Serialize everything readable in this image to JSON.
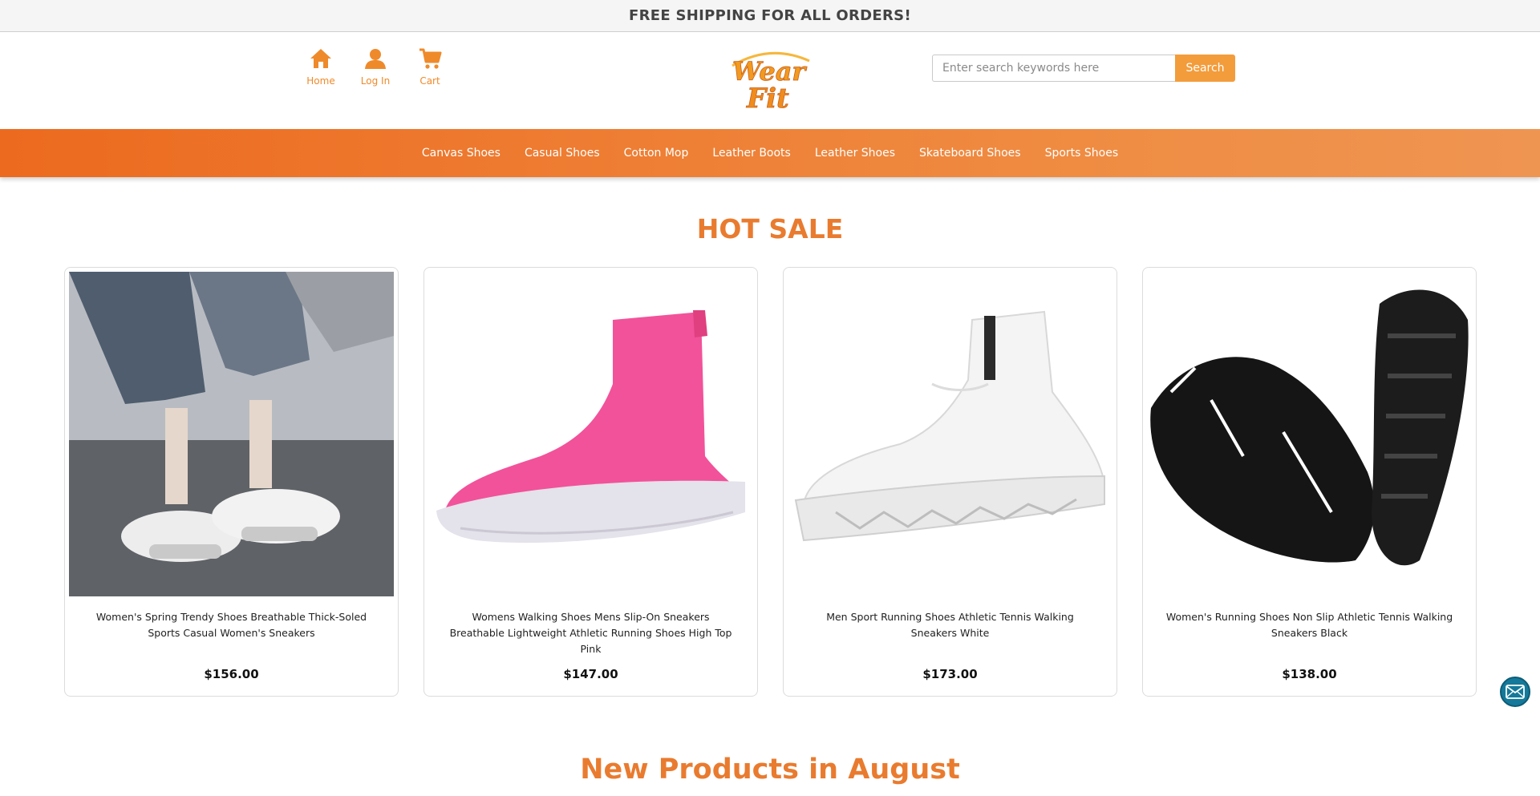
{
  "banner": {
    "text": "FREE SHIPPING FOR ALL ORDERS!"
  },
  "header": {
    "links": [
      {
        "label": "Home",
        "icon": "home-icon"
      },
      {
        "label": "Log In",
        "icon": "user-icon"
      },
      {
        "label": "Cart",
        "icon": "cart-icon"
      }
    ],
    "logo": {
      "text_line1": "Wear",
      "text_line2": "Fit"
    },
    "search": {
      "placeholder": "Enter search keywords here",
      "value": "",
      "button_label": "Search"
    }
  },
  "nav": {
    "items": [
      "Canvas Shoes",
      "Casual Shoes",
      "Cotton Mop",
      "Leather Boots",
      "Leather Shoes",
      "Skateboard Shoes",
      "Sports Shoes"
    ]
  },
  "hot_sale": {
    "title": "HOT SALE",
    "products": [
      {
        "name": "Women's Spring Trendy Shoes Breathable Thick-Soled Sports Casual Women's Sneakers",
        "price": "$156.00"
      },
      {
        "name": "Womens Walking Shoes Mens Slip-On Sneakers Breathable Lightweight Athletic Running Shoes High Top Pink",
        "price": "$147.00"
      },
      {
        "name": "Men Sport Running Shoes Athletic Tennis Walking Sneakers White",
        "price": "$173.00"
      },
      {
        "name": "Women's Running Shoes Non Slip Athletic Tennis Walking Sneakers Black",
        "price": "$138.00"
      }
    ]
  },
  "new_products": {
    "title": "New Products in August"
  },
  "colors": {
    "accent": "#ef8a2a",
    "nav_start": "#ec6a1f",
    "nav_end": "#ef9552",
    "title": "#e97b2f",
    "mail_button": "#14799a"
  }
}
